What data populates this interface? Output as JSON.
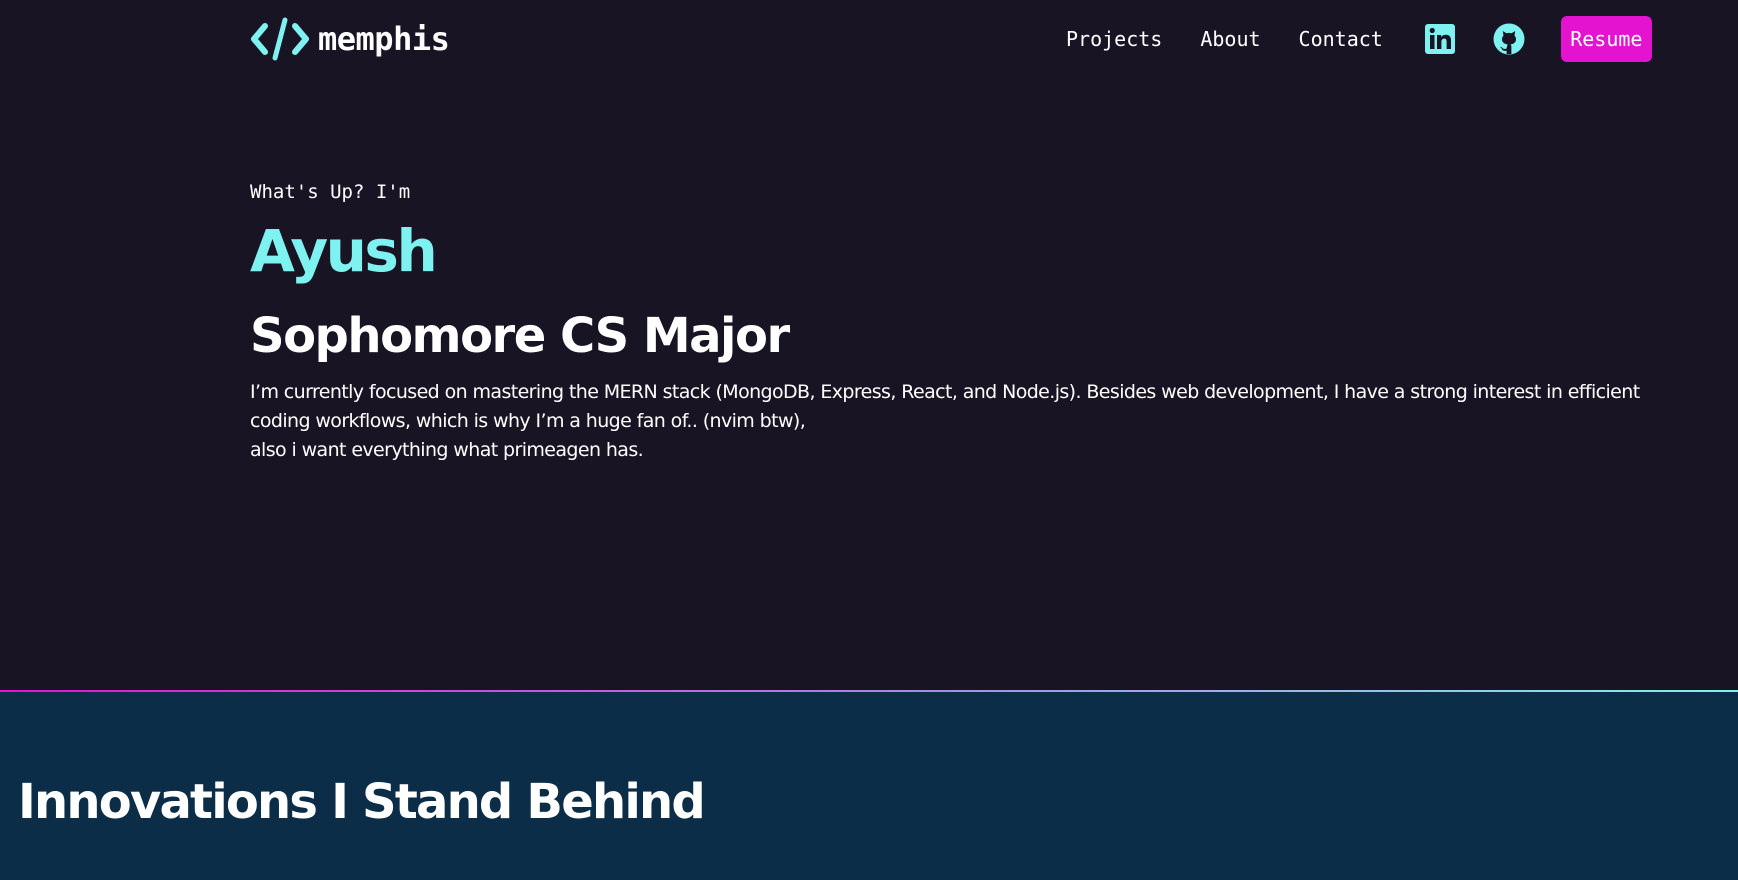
{
  "nav": {
    "logo_text": "memphis",
    "links": [
      "Projects",
      "About",
      "Contact"
    ],
    "resume_label": "Resume"
  },
  "hero": {
    "greeting": "What's Up? I'm",
    "name": "Ayush",
    "title": "Sophomore CS Major",
    "bio_line1": "I’m currently focused on mastering the MERN stack (MongoDB, Express, React, and Node.js). Besides web development, I have a strong interest in efficient coding workflows, which is why I’m a huge fan of.. (nvim btw),",
    "bio_line2": "also i want everything what primeagen has."
  },
  "innovations": {
    "title": "Innovations I Stand Behind"
  },
  "colors": {
    "background": "#191423",
    "accent_cyan": "#7ef2f0",
    "accent_magenta": "#e313d0",
    "section_background": "#0c2d48"
  },
  "icons": {
    "logo": "code-brackets-icon",
    "linkedin": "linkedin-icon",
    "github": "github-icon"
  }
}
